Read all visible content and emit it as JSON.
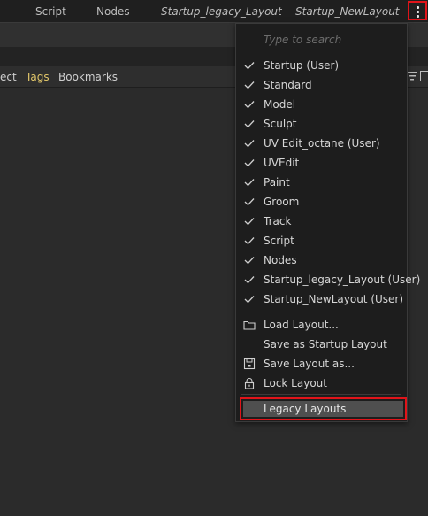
{
  "topbar": {
    "tabs": [
      {
        "label": "Script",
        "italic": false
      },
      {
        "label": "Nodes",
        "italic": false
      },
      {
        "label": "Startup_legacy_Layout",
        "italic": true
      },
      {
        "label": "Startup_NewLayout",
        "italic": true
      }
    ],
    "menu_icon": "vertical-ellipsis-icon"
  },
  "filterbar": {
    "tabs": [
      "ect",
      "Tags",
      "Bookmarks"
    ],
    "active_tab": "Tags",
    "icons": [
      "filter-icon",
      "window-icon"
    ]
  },
  "menu": {
    "search_placeholder": "Type to search",
    "layouts": [
      "Startup (User)",
      "Standard",
      "Model",
      "Sculpt",
      "UV Edit_octane (User)",
      "UVEdit",
      "Paint",
      "Groom",
      "Track",
      "Script",
      "Nodes",
      "Startup_legacy_Layout (User)",
      "Startup_NewLayout (User)"
    ],
    "check_icon": "checkmark-icon",
    "actions": [
      {
        "label": "Load Layout...",
        "icon": "folder-icon"
      },
      {
        "label": "Save as Startup Layout",
        "icon": ""
      },
      {
        "label": "Save Layout as...",
        "icon": "save-icon"
      },
      {
        "label": "Lock Layout",
        "icon": "lock-icon"
      }
    ],
    "legacy": "Legacy Layouts"
  },
  "colors": {
    "highlight_border": "#e0141a",
    "active_tab": "#e2c76a"
  }
}
